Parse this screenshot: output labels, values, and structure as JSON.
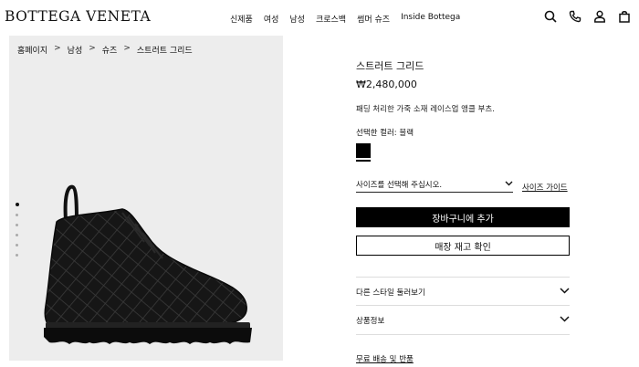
{
  "header": {
    "logo": "BOTTEGA VENETA",
    "nav": [
      "신제품",
      "여성",
      "남성",
      "크로스백",
      "썸머 슈즈",
      "Inside Bottega"
    ],
    "icons": [
      "search-icon",
      "phone-icon",
      "account-icon",
      "shopping-bag-icon"
    ]
  },
  "breadcrumb": [
    "홈페이지",
    "남성",
    "슈즈",
    "스트러트 그리드"
  ],
  "breadcrumb_sep": ">",
  "gallery": {
    "image_count": 6,
    "active_index": 0
  },
  "product": {
    "name": "스트러트 그리드",
    "price": "₩2,480,000",
    "description": "패딩 처리한 가죽 소재 레이스업 앵클 부츠.",
    "color_label": "선택한 컬러: 블랙",
    "swatch_color": "#000000",
    "size_placeholder": "사이즈를 선택해 주십시오.",
    "size_guide": "사이즈 가이드",
    "add_to_cart": "장바구니에 추가",
    "check_store_stock": "매장 재고 확인",
    "accordions": [
      "다른 스타일 둘러보기",
      "상품정보"
    ],
    "shipping_link": "무료 배송 및 반품"
  }
}
